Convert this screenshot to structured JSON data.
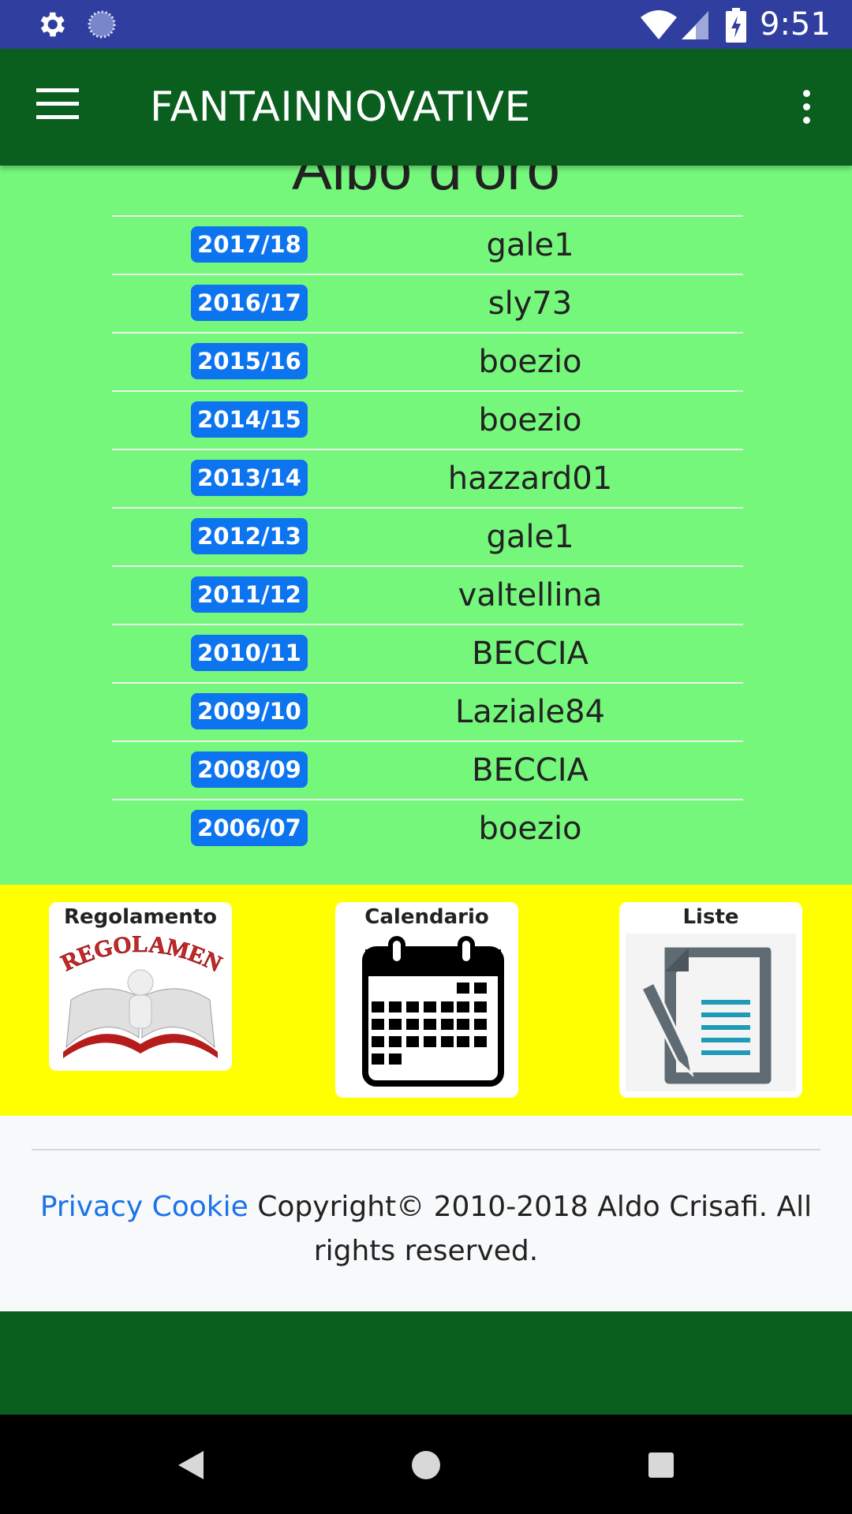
{
  "status_bar": {
    "time": "9:51",
    "icons": [
      "gear-icon",
      "circle-icon",
      "wifi-icon",
      "signal-icon",
      "battery-icon"
    ]
  },
  "app_bar": {
    "title": "FANTAINNOVATIVE",
    "menu_icon": "hamburger-icon",
    "overflow_icon": "more-vert-icon"
  },
  "section": {
    "title": "Albo d'oro"
  },
  "hall_of_fame": [
    {
      "season": "2017/18",
      "winner": "gale1"
    },
    {
      "season": "2016/17",
      "winner": "sly73"
    },
    {
      "season": "2015/16",
      "winner": "boezio"
    },
    {
      "season": "2014/15",
      "winner": "boezio"
    },
    {
      "season": "2013/14",
      "winner": "hazzard01"
    },
    {
      "season": "2012/13",
      "winner": "gale1"
    },
    {
      "season": "2011/12",
      "winner": "valtellina"
    },
    {
      "season": "2010/11",
      "winner": "BECCIA"
    },
    {
      "season": "2009/10",
      "winner": "Laziale84"
    },
    {
      "season": "2008/09",
      "winner": "BECCIA"
    },
    {
      "season": "2006/07",
      "winner": "boezio"
    }
  ],
  "shortcuts": [
    {
      "label": "Regolamento",
      "icon": "rulebook-icon",
      "image_text": "REGOLAMENTO"
    },
    {
      "label": "Calendario",
      "icon": "calendar-icon"
    },
    {
      "label": "Liste",
      "icon": "document-list-icon"
    }
  ],
  "footer": {
    "privacy_link": "Privacy Cookie",
    "copyright": "Copyright© 2010-2018 Aldo Crisafi. All rights reserved."
  },
  "colors": {
    "status_bar": "#303f9f",
    "app_bar": "#0a5e1e",
    "content_bg": "#75f77c",
    "badge": "#0d74f0",
    "shortcuts_bg": "#ffff00",
    "link": "#1a73e8"
  },
  "nav_bar": {
    "buttons": [
      "back-icon",
      "home-icon",
      "recents-icon"
    ]
  }
}
